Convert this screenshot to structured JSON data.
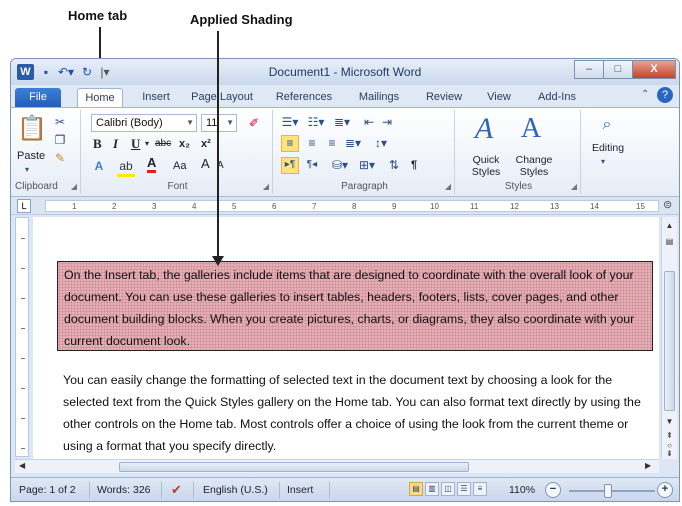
{
  "annotations": {
    "home_tab": "Home tab",
    "applied_shading": "Applied Shading"
  },
  "window": {
    "title": "Document1 - Microsoft Word",
    "app_icon": "W",
    "minimize_symbol": "–",
    "maximize_symbol": "□",
    "close_symbol": "X"
  },
  "tabs": [
    "File",
    "Home",
    "Insert",
    "Page Layout",
    "References",
    "Mailings",
    "Review",
    "View",
    "Add-Ins"
  ],
  "ribbon": {
    "clipboard": {
      "paste": "Paste",
      "label": "Clipboard"
    },
    "font": {
      "font_name": "Calibri (Body)",
      "font_size": "11",
      "bold": "B",
      "italic": "I",
      "underline": "U",
      "strikethrough": "abc",
      "subscript": "x₂",
      "superscript": "x²",
      "font_color": "A",
      "change_case": "Aa",
      "grow_font": "A",
      "shrink_font": "A",
      "label": "Font"
    },
    "paragraph": {
      "label": "Paragraph",
      "pilcrow": "¶"
    },
    "styles": {
      "quick_styles": "Quick Styles",
      "change_styles": "Change Styles",
      "label": "Styles"
    },
    "editing": {
      "label": "Editing"
    }
  },
  "ruler_numbers": [
    "1",
    "2",
    "3",
    "4",
    "5",
    "6",
    "7",
    "8",
    "9",
    "10",
    "11",
    "12",
    "13",
    "14",
    "15"
  ],
  "document": {
    "shaded_paragraph": "On the Insert tab, the galleries include items that are designed to coordinate with the overall look of your document. You can use these galleries to insert tables, headers, footers, lists, cover pages, and other document building blocks. When you create pictures, charts, or diagrams, they also coordinate with your current document look.",
    "plain_paragraph": "You can easily change the formatting of selected text in the document text by choosing a look for the selected text from the Quick Styles gallery on the Home tab. You can also format text directly by using the other controls on the Home tab. Most controls offer a choice of using the look from the current theme or using a format that you specify directly."
  },
  "status": {
    "page": "Page: 1 of 2",
    "words": "Words: 326",
    "language": "English (U.S.)",
    "mode": "Insert",
    "zoom": "110%",
    "zoom_minus": "−",
    "zoom_plus": "+"
  },
  "colors": {
    "shading": "#e8aeb6",
    "ribbon_accent": "#2b5aa8"
  }
}
